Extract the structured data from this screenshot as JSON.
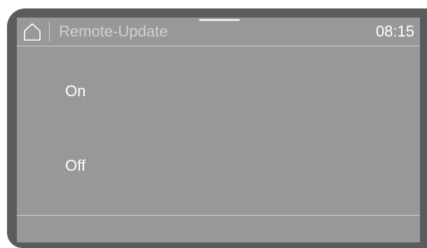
{
  "header": {
    "title": "Remote-Update",
    "time": "08:15",
    "home_icon": "home-icon"
  },
  "options": [
    {
      "label": "On"
    },
    {
      "label": "Off"
    }
  ],
  "colors": {
    "bezel": "#5b5b5d",
    "screen": "#97989a",
    "text": "#ffffff",
    "title_text": "#cfd0d2",
    "divider": "#cfd0d2"
  }
}
